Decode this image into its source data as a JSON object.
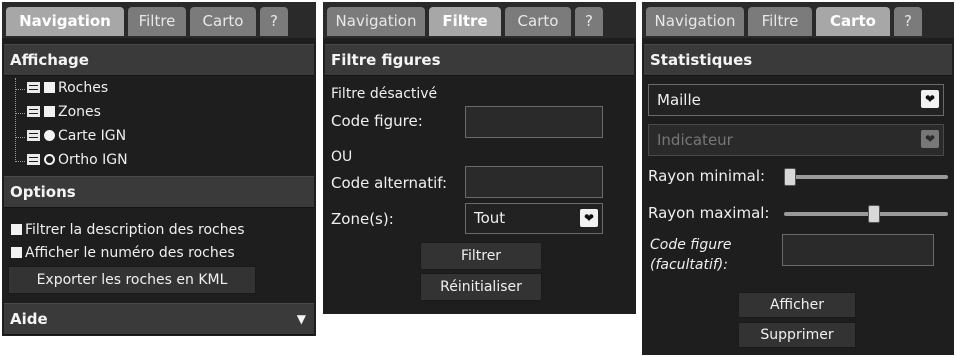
{
  "panel1": {
    "tabs": [
      "Navigation",
      "Filtre",
      "Carto",
      "?"
    ],
    "affichage_title": "Affichage",
    "layers": [
      {
        "label": "Roches"
      },
      {
        "label": "Zones"
      },
      {
        "label": "Carte IGN"
      },
      {
        "label": "Ortho IGN"
      }
    ],
    "options_title": "Options",
    "opt_filter_label": "Filtrer la description des roches",
    "opt_number_label": "Afficher le numéro des roches",
    "export_label": "Exporter les roches en KML",
    "aide_title": "Aide",
    "aide_arrow": "▼"
  },
  "panel2": {
    "tabs": [
      "Navigation",
      "Filtre",
      "Carto",
      "?"
    ],
    "section_title": "Filtre figures",
    "status": "Filtre désactivé",
    "code_figure_label": "Code figure:",
    "code_figure_value": "",
    "ou_label": "OU",
    "code_alt_label": "Code alternatif:",
    "code_alt_value": "",
    "zones_label": "Zone(s):",
    "zones_value": "Tout",
    "filter_button": "Filtrer",
    "reset_button": "Réinitialiser"
  },
  "panel3": {
    "tabs": [
      "Navigation",
      "Filtre",
      "Carto",
      "?"
    ],
    "section_title": "Statistiques",
    "maille_value": "Maille",
    "indicateur_value": "Indicateur",
    "rayon_min_label": "Rayon minimal:",
    "rayon_min_level": 0.0,
    "rayon_max_label": "Rayon maximal:",
    "rayon_max_level": 0.55,
    "code_figure_label_1": "Code figure",
    "code_figure_label_2": "(facultatif):",
    "code_figure_value": "",
    "show_button": "Afficher",
    "delete_button": "Supprimer"
  },
  "colors": {
    "panel_bg": "#1e1e1e",
    "tab_active": "#a7a7a7",
    "tab_inactive": "#7b7b7b",
    "section_bg": "#3a3a3a"
  },
  "icons": [
    "layer-list-icon",
    "checkbox-icon",
    "radio-icon",
    "chevron-down-icon",
    "triangle-down-icon",
    "slider-handle-icon"
  ]
}
